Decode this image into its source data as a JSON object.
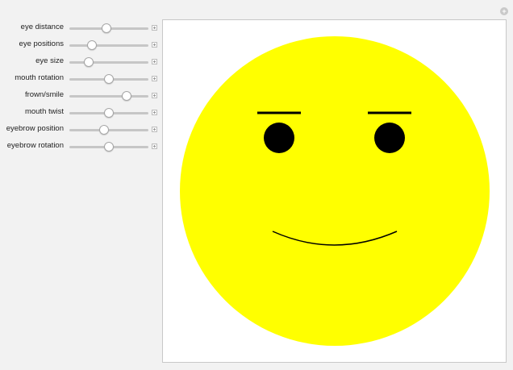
{
  "window": {
    "corner_button_glyph": "+"
  },
  "controls": [
    {
      "label": "eye distance",
      "value": 0.47
    },
    {
      "label": "eye positions",
      "value": 0.29
    },
    {
      "label": "eye size",
      "value": 0.24
    },
    {
      "label": "mouth rotation",
      "value": 0.5
    },
    {
      "label": "frown/smile",
      "value": 0.72
    },
    {
      "label": "mouth twist",
      "value": 0.5
    },
    {
      "label": "eyebrow position",
      "value": 0.44
    },
    {
      "label": "eyebrow rotation",
      "value": 0.5
    }
  ],
  "colors": {
    "face": "#ffff00",
    "features": "#000000"
  }
}
